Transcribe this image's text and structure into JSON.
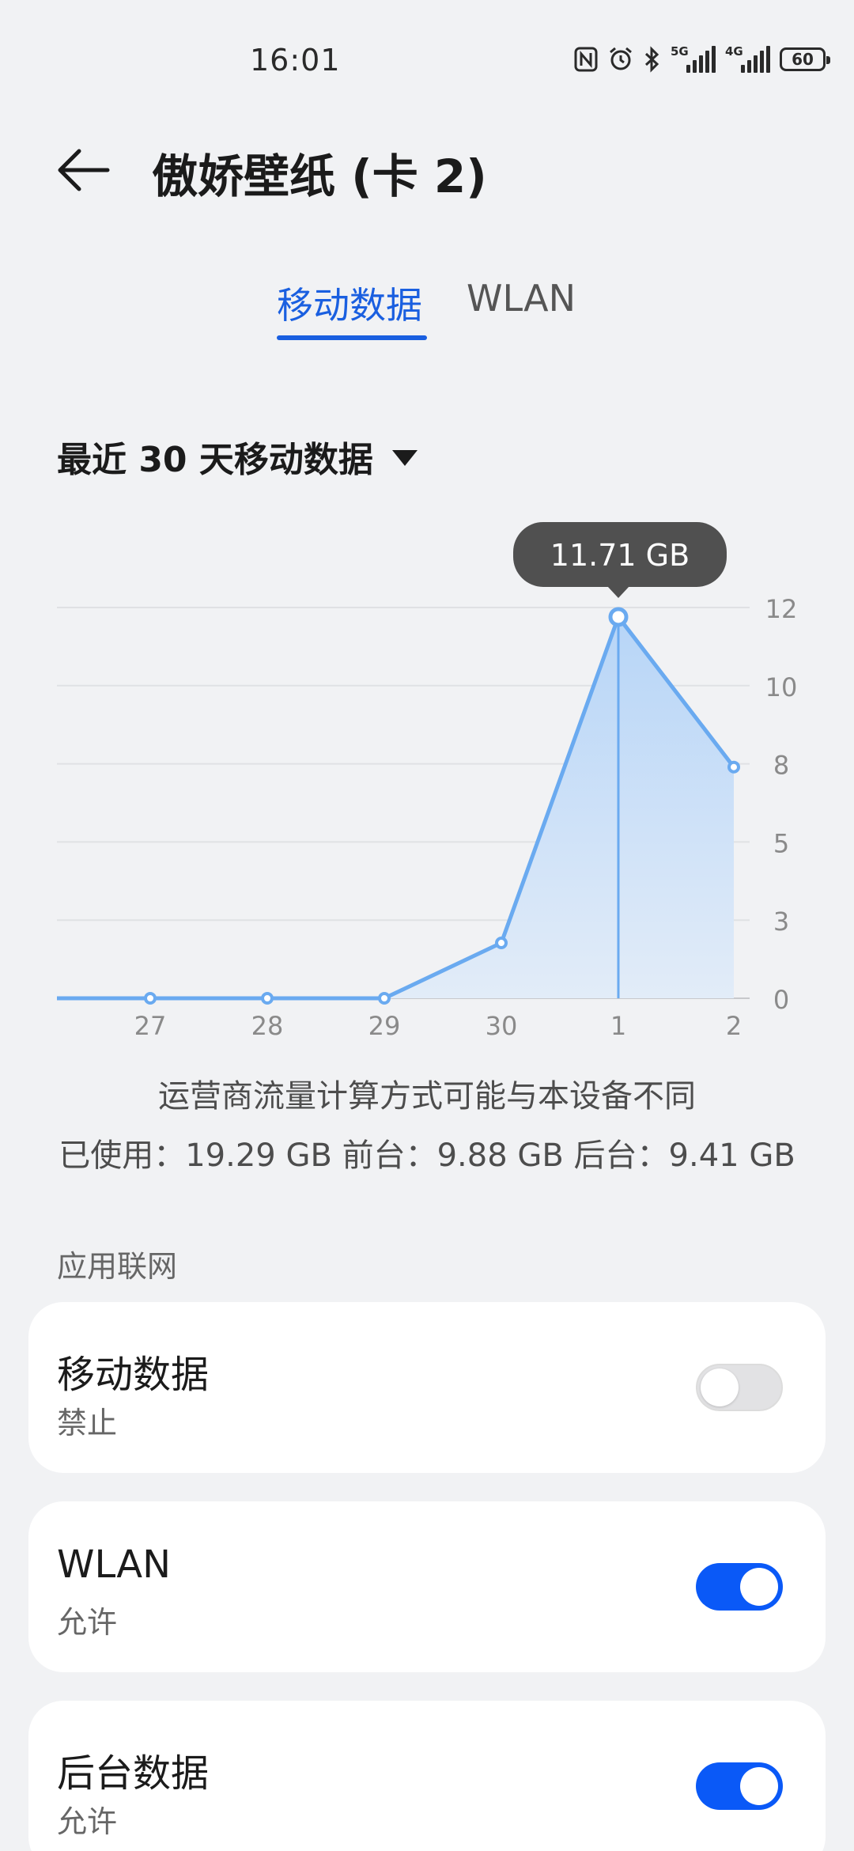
{
  "status_bar": {
    "time": "16:01",
    "icons": [
      "nfc-icon",
      "alarm-icon",
      "bluetooth-icon",
      "signal-5g-icon",
      "signal-4g-icon",
      "battery-icon"
    ],
    "signal_1_label": "5G",
    "signal_2_label": "4G",
    "battery_level": "60"
  },
  "header": {
    "back_icon": "back-arrow-icon",
    "title": "傲娇壁纸 (卡 2)"
  },
  "tabs": [
    {
      "label": "移动数据",
      "active": true
    },
    {
      "label": "WLAN",
      "active": false
    }
  ],
  "range_selector": {
    "label": "最近 30 天移动数据",
    "icon": "caret-down-icon"
  },
  "chart_data": {
    "type": "area",
    "categories": [
      "27",
      "28",
      "29",
      "30",
      "1",
      "2"
    ],
    "x_start": "26",
    "values": [
      0,
      0,
      0,
      0,
      1.7,
      11.71,
      7.1
    ],
    "selected_index": 5,
    "tooltip": "11.71 GB",
    "y_ticks": [
      "0",
      "3",
      "5",
      "8",
      "10",
      "12"
    ],
    "y_max": 12,
    "ylim": [
      0,
      12
    ],
    "grid": true,
    "axis_position": "right",
    "line_color": "#6aaaf0",
    "fill_color_top": "#b7d5f7",
    "fill_color_bottom": "#e2ecf8"
  },
  "note": "运营商流量计算方式可能与本设备不同",
  "usage": "已使用：19.29 GB 前台：9.88 GB 后台：9.41 GB",
  "section_title": "应用联网",
  "cards": [
    {
      "title": "移动数据",
      "subtitle": "禁止",
      "enabled": false
    },
    {
      "title": "WLAN",
      "subtitle": "允许",
      "enabled": true
    },
    {
      "title": "后台数据",
      "subtitle": "允许",
      "enabled": true
    }
  ],
  "colors": {
    "accent": "#1a5fe0",
    "toggle_on": "#0a59f7",
    "toggle_off": "#e2e2e4",
    "background": "#f1f2f4",
    "card": "#ffffff"
  }
}
